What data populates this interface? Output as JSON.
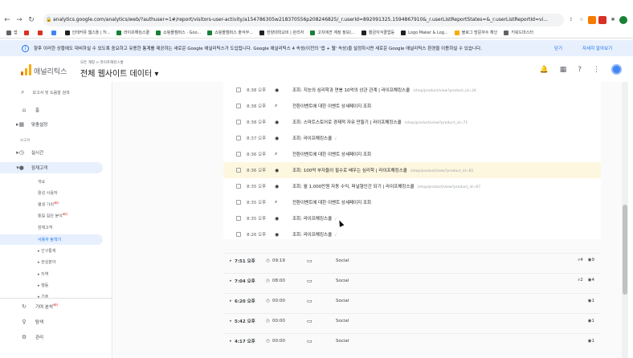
{
  "browser": {
    "url": "analytics.google.com/analytics/web/?authuser=1#/report/visitors-user-activity/a154786305w218370556p208246825/_r.userId=892091325.1594867910&_r.userListReportStates=&_r.userListReportId=vi...",
    "bookmarks": [
      "앱",
      "",
      "",
      "",
      "인테커뮤 웹스톨 | Tr...",
      "라이프해킹스쿨",
      "쇼핑몰캠퍼스 · Goo...",
      "쇼핑몰캠퍼스 출석부...",
      "한양대학교비 | 관리자",
      "고치애견 계정 정보(...",
      "황금지식클럽등",
      "Logo Maker & Log...",
      "블로그 방문자수 확인",
      "키워드마스터"
    ]
  },
  "banner": {
    "text": "향후 이러한 상황에도 대비하실 수 있도록 중요하고 유용한 통계를 제공하는 새로운 Google 애널리틱스가 도입됩니다. Google 애널리틱스 4 속성(이전의 '앱 + 웹' 속성)을 설정하시면 새로운 Google 애널리틱스 환경을 이용하실 수 있습니다.",
    "action1": "닫기",
    "action2": "자세히 알아보기"
  },
  "header": {
    "app_name": "애널리틱스",
    "breadcrumb": "모든 계정 > 라이프해킹스쿨",
    "property": "전체 웹사이트 데이터 ▾",
    "notification_count": "1"
  },
  "sidebar": {
    "search_placeholder": "보고서 및 도움말 검색",
    "home": "홈",
    "custom": "맞춤설정",
    "section_reports": "보고서",
    "realtime": "실시간",
    "audience": "잠재고객",
    "audience_items": [
      "개요",
      "활성 사용자",
      "평생 가치",
      "동질 집단 분석",
      "잠재고객",
      "사용자 탐색기"
    ],
    "badge": "베타",
    "sub_groups": [
      "인구통계",
      "관심분야",
      "지역",
      "행동",
      "기술"
    ],
    "attribution": "기여 분석",
    "discover": "탐색",
    "admin": "관리"
  },
  "activities": [
    {
      "time": "8:38 오후",
      "icon": "eye",
      "title": "조회: 지능의 심리학과 연봉 10억의 상관 관계 | 라이프해킹스쿨",
      "path": "/shop/product/view?product_id=34"
    },
    {
      "time": "8:38 오후",
      "icon": "event",
      "title": "전환이벤트에 대한 이벤트 상세페이지 조회",
      "path": ""
    },
    {
      "time": "8:38 오후",
      "icon": "eye",
      "title": "조회: 스마트스토어로 경제적 자유 만들기 | 라이프해킹스쿨",
      "path": "/shop/product/view?product_id=71"
    },
    {
      "time": "8:37 오후",
      "icon": "eye",
      "title": "조회: 라이프해킹스쿨",
      "path": "/"
    },
    {
      "time": "8:36 오후",
      "icon": "event",
      "title": "전환이벤트에 대한 이벤트 상세페이지 조회",
      "path": ""
    },
    {
      "time": "8:36 오후",
      "icon": "eye",
      "title": "조회: 100억 부자들이 필수로 배우는 심리학 | 라이프해킹스쿨",
      "path": "/shop/product/view?product_id=81"
    },
    {
      "time": "8:35 오후",
      "icon": "eye",
      "title": "조회: 월 1,000만원 자동 수익, 퍼널형인간 되기 | 라이프해킹스쿨",
      "path": "/shop/product/view?product_id=67"
    },
    {
      "time": "8:35 오후",
      "icon": "event",
      "title": "전환이벤트에 대한 이벤트 상세페이지 조회",
      "path": ""
    },
    {
      "time": "8:35 오후",
      "icon": "eye",
      "title": "조회: 라이프해킹스쿨",
      "path": "/"
    },
    {
      "time": "8:26 오후",
      "icon": "eye",
      "title": "조회: 라이프해킹스쿨",
      "path": "/"
    }
  ],
  "sessions": [
    {
      "start": "7:51 오후",
      "duration": "09:19",
      "channel": "Social",
      "meta": [
        "4",
        "9"
      ]
    },
    {
      "start": "7:04 오후",
      "duration": "08:00",
      "channel": "Social",
      "meta": [
        "2",
        "4"
      ]
    },
    {
      "start": "6:20 오후",
      "duration": "00:00",
      "channel": "Social",
      "meta": [
        "",
        "1"
      ]
    },
    {
      "start": "5:42 오후",
      "duration": "00:00",
      "channel": "Social",
      "meta": [
        "",
        "1"
      ]
    },
    {
      "start": "4:17 오후",
      "duration": "00:00",
      "channel": "Social",
      "meta": [
        "",
        "1"
      ]
    }
  ]
}
